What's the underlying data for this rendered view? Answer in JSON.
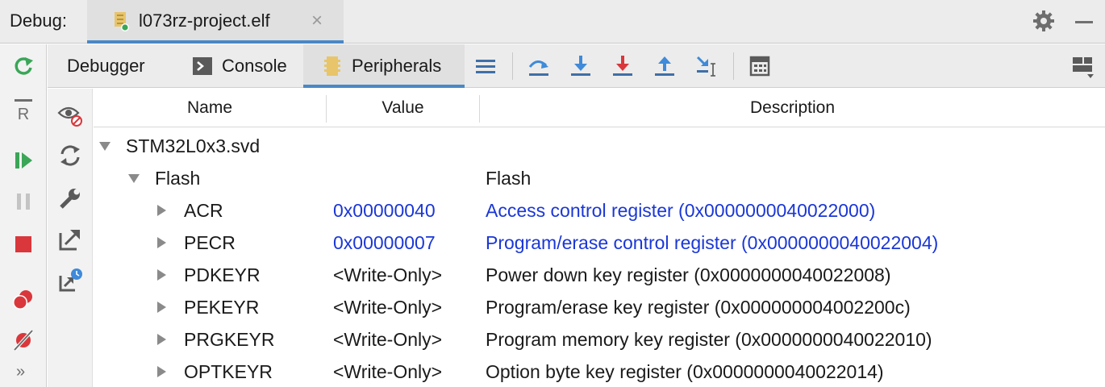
{
  "topbar": {
    "label": "Debug:",
    "session_tab": "l073rz-project.elf",
    "close_glyph": "×",
    "icons": [
      "elf-file-icon",
      "gear-icon",
      "minimize-icon"
    ]
  },
  "left_toolbar": {
    "icons": [
      "rerun-icon",
      "restart-icon",
      "resume-icon",
      "pause-icon",
      "stop-icon",
      "breakpoints-icon",
      "mute-breakpoints-icon",
      "more-icon"
    ],
    "more_glyph": "»"
  },
  "tabs": [
    {
      "label": "Debugger",
      "active": false
    },
    {
      "label": "Console",
      "active": false
    },
    {
      "label": "Peripherals",
      "active": true
    }
  ],
  "tab_toolbar_icons": [
    "frames-menu-icon",
    "step-over-icon",
    "step-into-icon",
    "force-step-into-icon",
    "step-out-icon",
    "run-to-cursor-icon",
    "evaluate-expression-icon",
    "layout-icon"
  ],
  "peripheral_toolbar_icons": [
    "hide-icon",
    "refresh-icon",
    "configure-icon",
    "export-icon",
    "export-later-icon"
  ],
  "table": {
    "columns": [
      "Name",
      "Value",
      "Description"
    ],
    "rows": [
      {
        "name": "STM32L0x3.svd",
        "value": "",
        "description": "",
        "level": 0,
        "expanded": true,
        "link": false
      },
      {
        "name": "Flash",
        "value": "",
        "description": "Flash",
        "level": 1,
        "expanded": true,
        "link": false
      },
      {
        "name": "ACR",
        "value": "0x00000040",
        "description": "Access control register (0x0000000040022000)",
        "level": 2,
        "expanded": false,
        "link": true
      },
      {
        "name": "PECR",
        "value": "0x00000007",
        "description": "Program/erase control register (0x0000000040022004)",
        "level": 2,
        "expanded": false,
        "link": true
      },
      {
        "name": "PDKEYR",
        "value": "<Write-Only>",
        "description": "Power down key register (0x0000000040022008)",
        "level": 2,
        "expanded": false,
        "link": false
      },
      {
        "name": "PEKEYR",
        "value": "<Write-Only>",
        "description": "Program/erase key register (0x000000004002200c)",
        "level": 2,
        "expanded": false,
        "link": false
      },
      {
        "name": "PRGKEYR",
        "value": "<Write-Only>",
        "description": "Program memory key register (0x0000000040022010)",
        "level": 2,
        "expanded": false,
        "link": false
      },
      {
        "name": "OPTKEYR",
        "value": "<Write-Only>",
        "description": "Option byte key register (0x0000000040022014)",
        "level": 2,
        "expanded": false,
        "link": false
      }
    ]
  },
  "colors": {
    "accent": "#4a88c7",
    "link_value": "#1a37d6",
    "green": "#3aa657",
    "red": "#d9373c"
  }
}
